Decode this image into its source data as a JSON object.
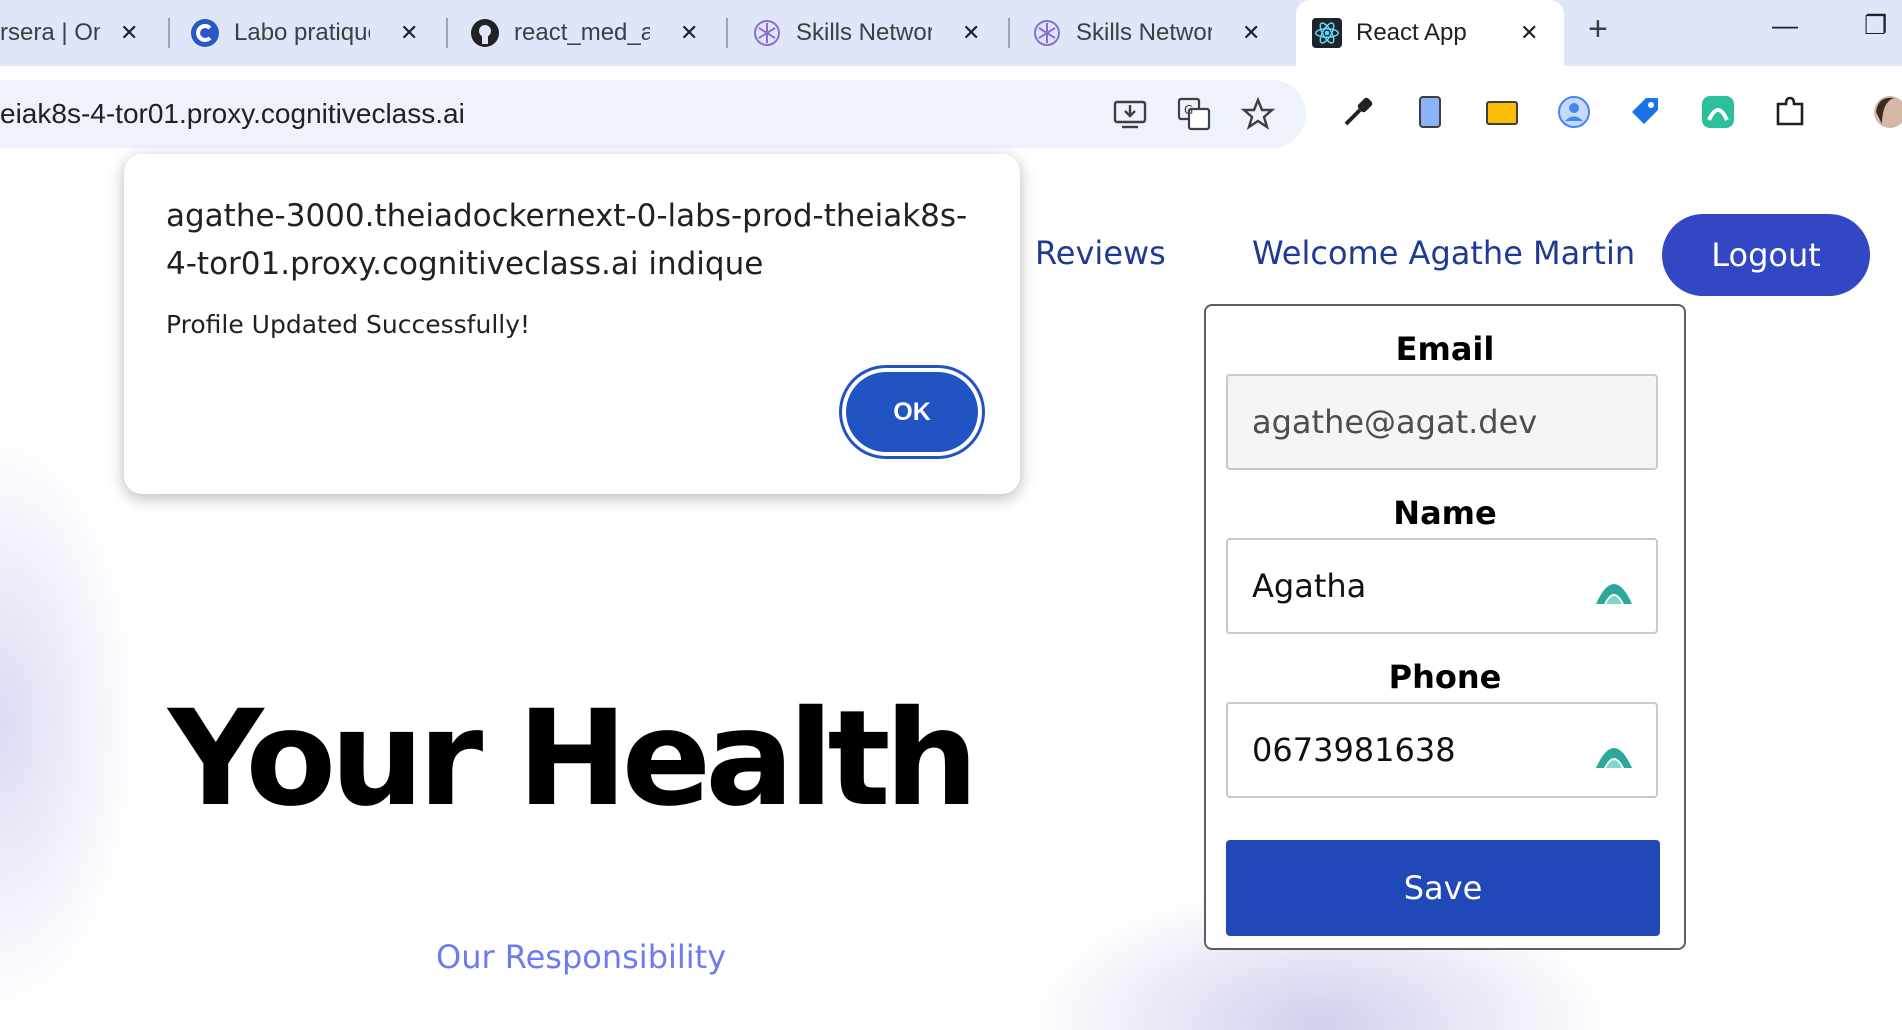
{
  "browser": {
    "tabs": [
      {
        "title": "rsera | On",
        "icon": "coursera-icon"
      },
      {
        "title": "Labo pratique",
        "icon": "coursera-c-icon"
      },
      {
        "title": "react_med_ap",
        "icon": "github-icon"
      },
      {
        "title": "Skills Networ",
        "icon": "skills-network-icon"
      },
      {
        "title": "Skills Networ",
        "icon": "skills-network-icon"
      },
      {
        "title": "React App",
        "icon": "react-icon"
      }
    ],
    "new_tab": "+",
    "minimize": "—",
    "restore": "❐",
    "url": "eiak8s-4-tor01.proxy.cognitiveclass.ai"
  },
  "nav": {
    "reviews": "Reviews",
    "welcome": "Welcome Agathe Martin",
    "logout": "Logout"
  },
  "hero": {
    "title": "Your Health",
    "subtitle": "Our Responsibility"
  },
  "profile_form": {
    "email_label": "Email",
    "email_value": "agathe@agat.dev",
    "name_label": "Name",
    "name_value": "Agatha",
    "phone_label": "Phone",
    "phone_value": "0673981638",
    "save_label": "Save"
  },
  "dialog": {
    "title": "agathe-3000.theiadockernext-0-labs-prod-theiak8s-4-tor01.proxy.cognitiveclass.ai indique",
    "message": "Profile Updated Successfully!",
    "ok_label": "OK"
  },
  "colors": {
    "accent": "#3346c4",
    "save": "#2148b8",
    "link": "#1f3a93",
    "tabstrip": "#dee6f7"
  }
}
